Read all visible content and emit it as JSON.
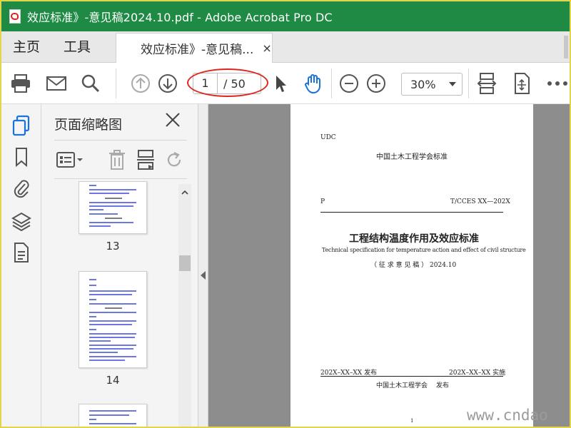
{
  "window": {
    "title": "效应标准》-意见稿2024.10.pdf - Adobe Acrobat Pro DC"
  },
  "menu": {
    "home": "主页",
    "tools": "工具"
  },
  "tab": {
    "label": "效应标准》-意见稿...",
    "close": "×"
  },
  "toolbar": {
    "print_icon": "print-icon",
    "mail_icon": "mail-icon",
    "search_icon": "search-icon",
    "page_current": "1",
    "page_total": "/ 50",
    "zoom": "30%"
  },
  "panel": {
    "title": "页面缩略图",
    "thumbnails": [
      {
        "label": "13"
      },
      {
        "label": "14"
      }
    ]
  },
  "document": {
    "udc": "UDC",
    "org_header": "中国土木工程学会标准",
    "p_label": "P",
    "std_code": "T/CCES XX—202X",
    "title_cn": "工程结构温度作用及效应标准",
    "title_en": "Technical specification for temperature action and effect of civil structure",
    "draft": "（ 征 求 意 见 稿 ） 2024.10",
    "publish_date": "202X–XX–XX 发布",
    "effective_date": "202X–XX–XX 实施",
    "publisher": "中国土木工程学会",
    "publish_word": "发布",
    "page_number": "1"
  },
  "watermark": "www.cndao",
  "colors": {
    "titlebar": "#1e8a43",
    "accent_blue": "#1a73d8",
    "highlight_red": "#e0241c"
  }
}
